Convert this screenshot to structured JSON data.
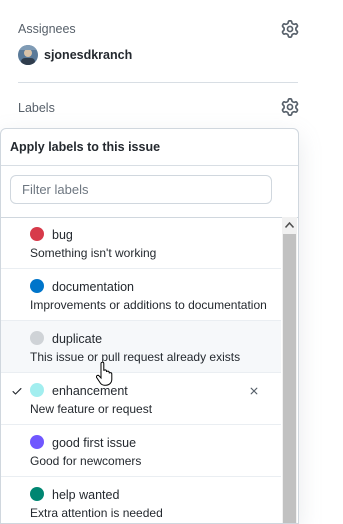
{
  "assignees": {
    "title": "Assignees",
    "user": "sjonesdkranch"
  },
  "labels_section": {
    "title": "Labels"
  },
  "popover": {
    "title": "Apply labels to this issue",
    "filter_placeholder": "Filter labels",
    "labels": [
      {
        "name": "bug",
        "description": "Something isn't working",
        "color": "#d73a4a",
        "selected": false
      },
      {
        "name": "documentation",
        "description": "Improvements or additions to documentation",
        "color": "#0075ca",
        "selected": false
      },
      {
        "name": "duplicate",
        "description": "This issue or pull request already exists",
        "color": "#cfd3d7",
        "selected": false
      },
      {
        "name": "enhancement",
        "description": "New feature or request",
        "color": "#a2eeef",
        "selected": true
      },
      {
        "name": "good first issue",
        "description": "Good for newcomers",
        "color": "#7057ff",
        "selected": false
      },
      {
        "name": "help wanted",
        "description": "Extra attention is needed",
        "color": "#008672",
        "selected": false
      }
    ]
  }
}
